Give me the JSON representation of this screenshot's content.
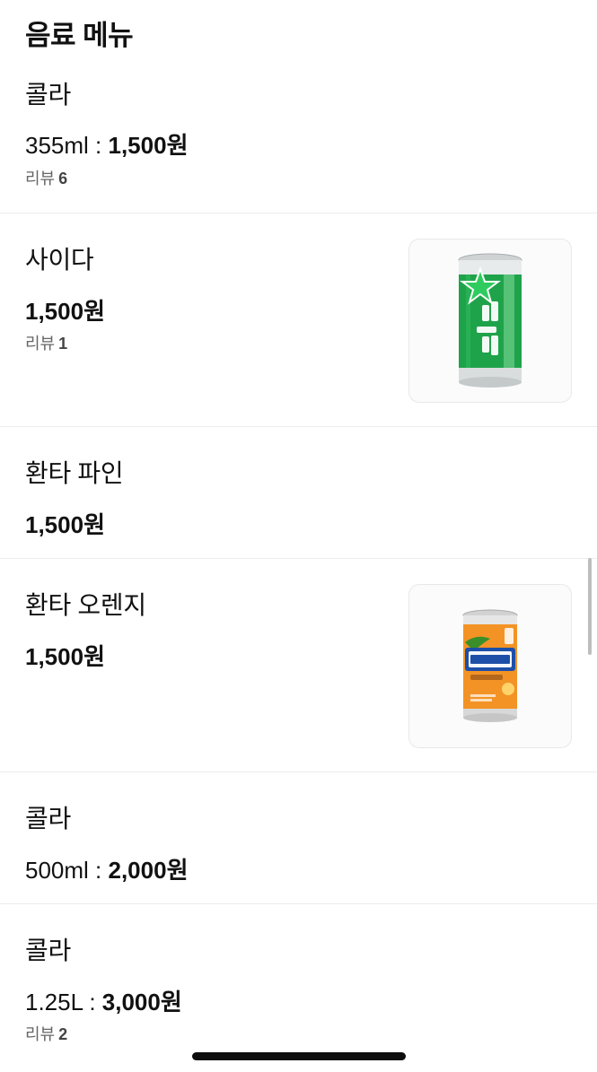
{
  "section": {
    "title": "음료 메뉴"
  },
  "items": [
    {
      "name": "콜라",
      "option": "355ml",
      "sep": " : ",
      "price": "1,500원",
      "review_label": "리뷰",
      "review_count": "6"
    },
    {
      "name": "사이다",
      "price": "1,500원",
      "review_label": "리뷰",
      "review_count": "1",
      "image": "sprite-can-image"
    },
    {
      "name": "환타 파인",
      "price": "1,500원"
    },
    {
      "name": "환타 오렌지",
      "price": "1,500원",
      "image": "fanta-orange-can-image"
    },
    {
      "name": "콜라",
      "option": "500ml",
      "sep": " : ",
      "price": "2,000원"
    },
    {
      "name": "콜라",
      "option": "1.25L",
      "sep": " : ",
      "price": "3,000원",
      "review_label": "리뷰",
      "review_count": "2"
    }
  ],
  "colors": {
    "cider_green": "#1fa34a",
    "fanta_orange": "#f39325",
    "fanta_blue": "#1e4fa8"
  }
}
